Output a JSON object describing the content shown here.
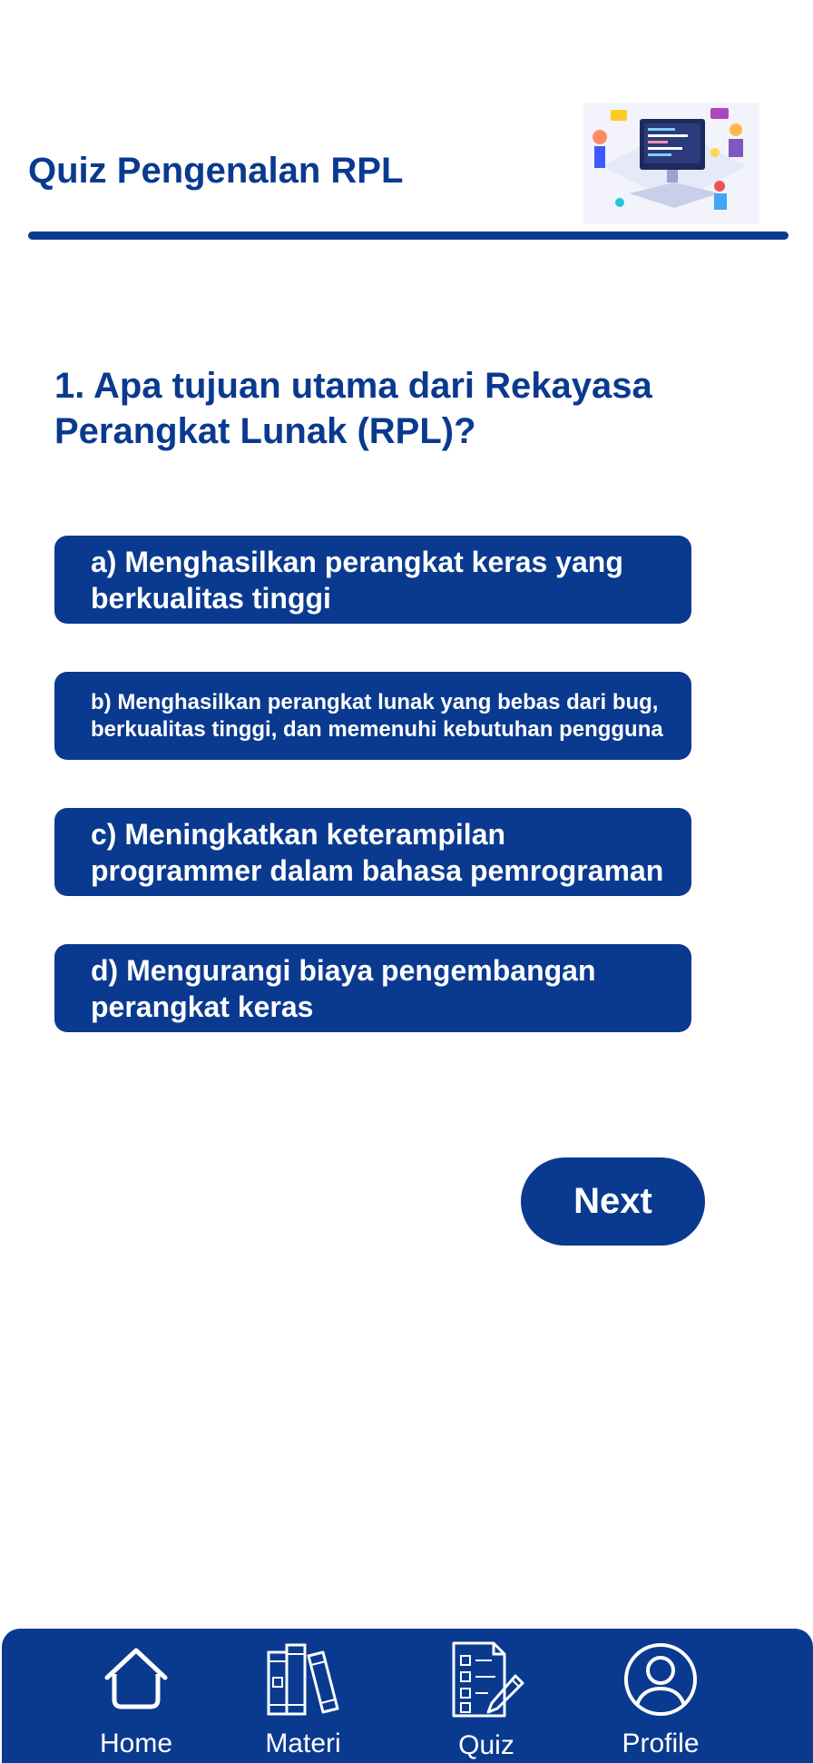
{
  "header": {
    "title": "Quiz Pengenalan RPL"
  },
  "quiz": {
    "question": "1. Apa tujuan utama dari Rekayasa Perangkat Lunak (RPL)?",
    "options": [
      {
        "label": "a) Menghasilkan perangkat keras yang berkualitas tinggi"
      },
      {
        "label": "b) Menghasilkan perangkat lunak yang bebas dari bug, berkualitas tinggi, dan memenuhi kebutuhan pengguna"
      },
      {
        "label": "c) Meningkatkan keterampilan programmer dalam bahasa pemrograman"
      },
      {
        "label": "d) Mengurangi biaya pengembangan perangkat keras"
      }
    ],
    "next_label": "Next"
  },
  "nav": {
    "items": [
      {
        "label": "Home",
        "icon": "home-icon"
      },
      {
        "label": "Materi",
        "icon": "books-icon"
      },
      {
        "label": "Quiz",
        "icon": "quiz-checklist-icon"
      },
      {
        "label": "Profile",
        "icon": "profile-icon"
      }
    ]
  },
  "colors": {
    "primary": "#0a3a8f",
    "background": "#ffffff",
    "on_primary": "#ffffff"
  }
}
